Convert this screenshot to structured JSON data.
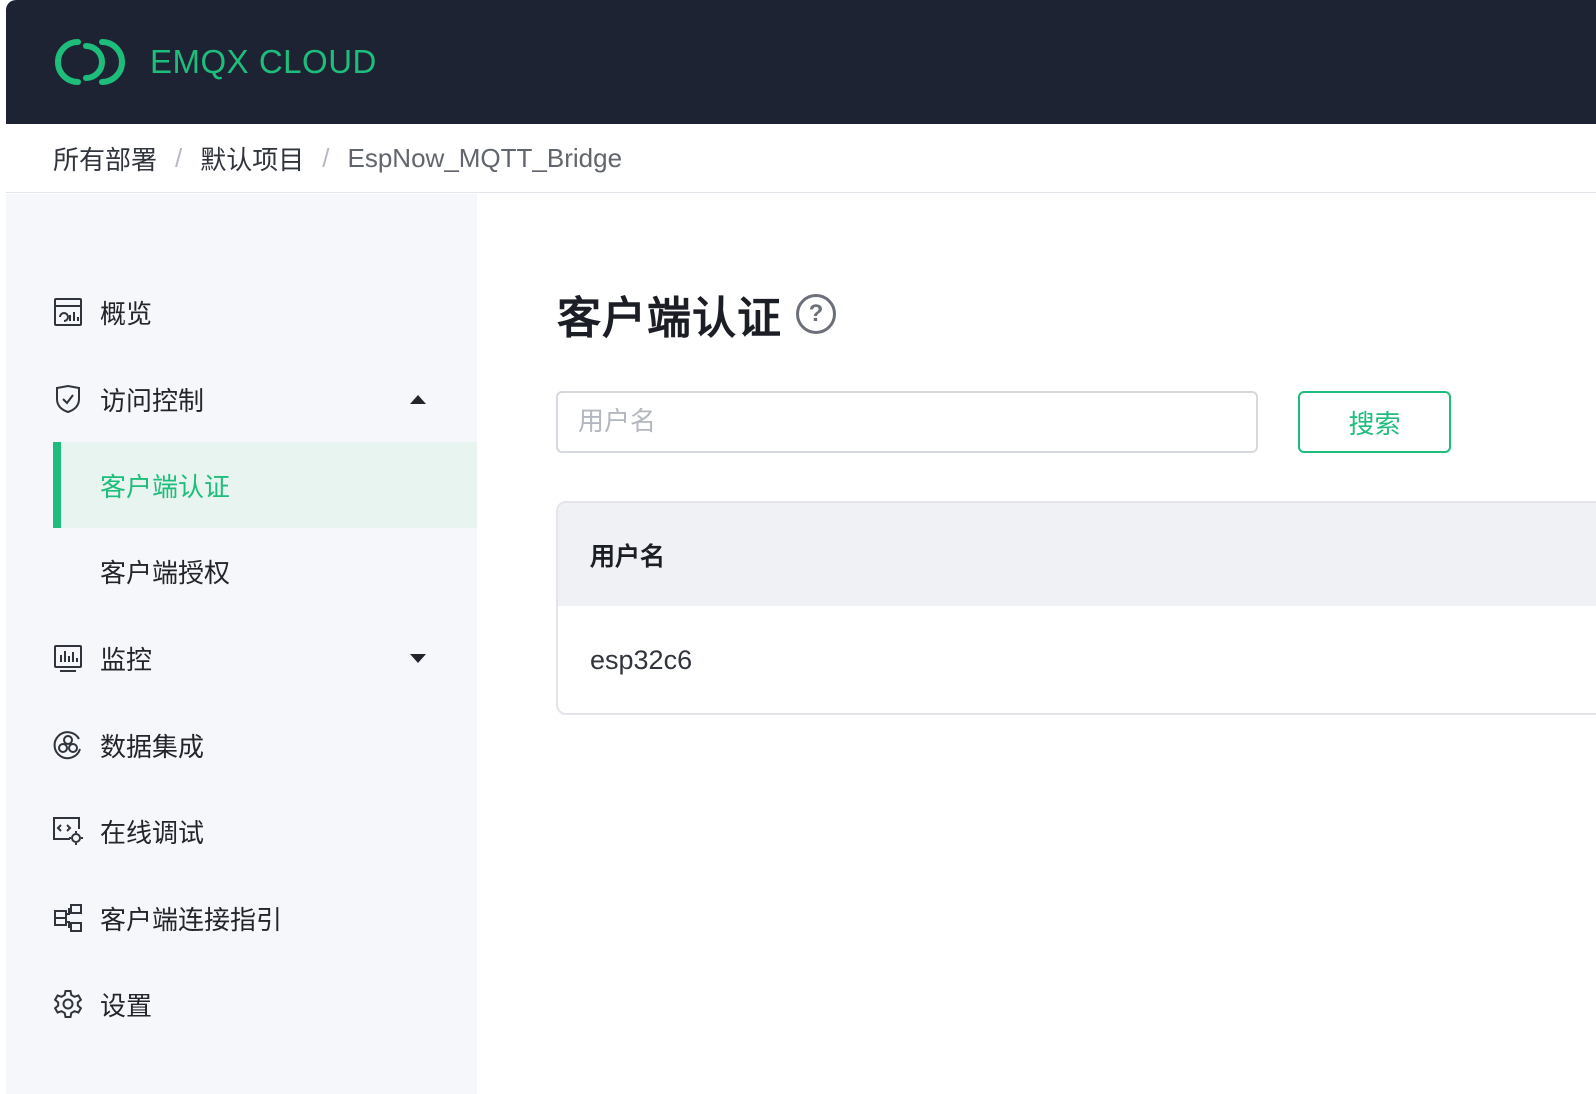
{
  "header": {
    "brand": "EMQX CLOUD",
    "brand_color": "#1fbd7c"
  },
  "breadcrumb": {
    "items": [
      "所有部署",
      "默认项目",
      "EspNow_MQTT_Bridge"
    ],
    "separator": "/"
  },
  "sidebar": {
    "items": [
      {
        "label": "概览",
        "icon": "dashboard-icon"
      },
      {
        "label": "访问控制",
        "icon": "shield-check-icon",
        "expanded": true
      },
      {
        "label": "客户端认证",
        "sub": true,
        "active": true
      },
      {
        "label": "客户端授权",
        "sub": true
      },
      {
        "label": "监控",
        "icon": "monitor-chart-icon",
        "expanded": false
      },
      {
        "label": "数据集成",
        "icon": "integration-icon"
      },
      {
        "label": "在线调试",
        "icon": "debug-icon"
      },
      {
        "label": "客户端连接指引",
        "icon": "connection-guide-icon"
      },
      {
        "label": "设置",
        "icon": "gear-icon"
      }
    ]
  },
  "main": {
    "title": "客户端认证",
    "help_glyph": "?",
    "search": {
      "placeholder": "用户名",
      "value": "",
      "button_label": "搜索"
    },
    "table": {
      "columns": [
        "用户名"
      ],
      "rows": [
        [
          "esp32c6"
        ]
      ]
    }
  }
}
